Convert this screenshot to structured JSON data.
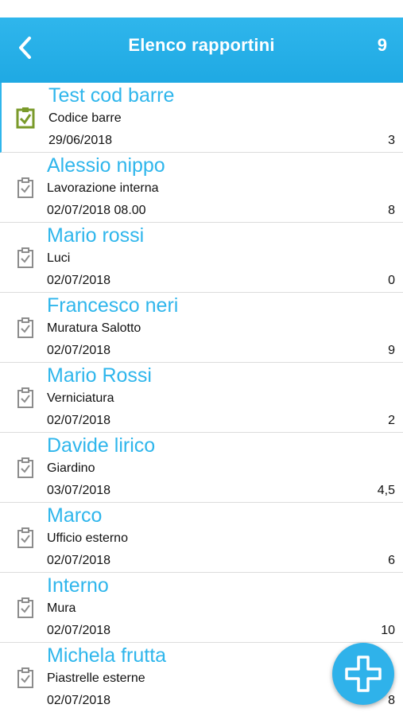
{
  "header": {
    "title": "Elenco rapportini",
    "count": "9"
  },
  "colors": {
    "accent": "#2fb6ec",
    "selected_icon": "#7a9a2a",
    "icon": "#8c8c8c"
  },
  "items": [
    {
      "name": "Test cod barre",
      "description": "Codice barre",
      "date": "29/06/2018",
      "count": "3",
      "selected": true,
      "icon": "clipboard-check-icon"
    },
    {
      "name": "Alessio nippo",
      "description": "Lavorazione interna",
      "date": "02/07/2018 08.00",
      "count": "8",
      "selected": false,
      "icon": "clipboard-check-icon"
    },
    {
      "name": "Mario rossi",
      "description": "Luci",
      "date": "02/07/2018",
      "count": "0",
      "selected": false,
      "icon": "clipboard-check-icon"
    },
    {
      "name": "Francesco neri",
      "description": "Muratura Salotto",
      "date": "02/07/2018",
      "count": "9",
      "selected": false,
      "icon": "clipboard-check-icon"
    },
    {
      "name": "Mario Rossi",
      "description": "Verniciatura",
      "date": "02/07/2018",
      "count": "2",
      "selected": false,
      "icon": "clipboard-check-icon"
    },
    {
      "name": "Davide lirico",
      "description": "Giardino",
      "date": "03/07/2018",
      "count": "4,5",
      "selected": false,
      "icon": "clipboard-check-icon"
    },
    {
      "name": "Marco",
      "description": "Ufficio esterno",
      "date": "02/07/2018",
      "count": "6",
      "selected": false,
      "icon": "clipboard-check-icon"
    },
    {
      "name": "Interno",
      "description": "Mura",
      "date": "02/07/2018",
      "count": "10",
      "selected": false,
      "icon": "clipboard-check-icon"
    },
    {
      "name": "Michela frutta",
      "description": "Piastrelle esterne",
      "date": "02/07/2018",
      "count": "8",
      "selected": false,
      "icon": "clipboard-check-icon"
    }
  ],
  "fab": {
    "icon": "plus-icon"
  },
  "back": {
    "icon": "chevron-left-icon"
  }
}
